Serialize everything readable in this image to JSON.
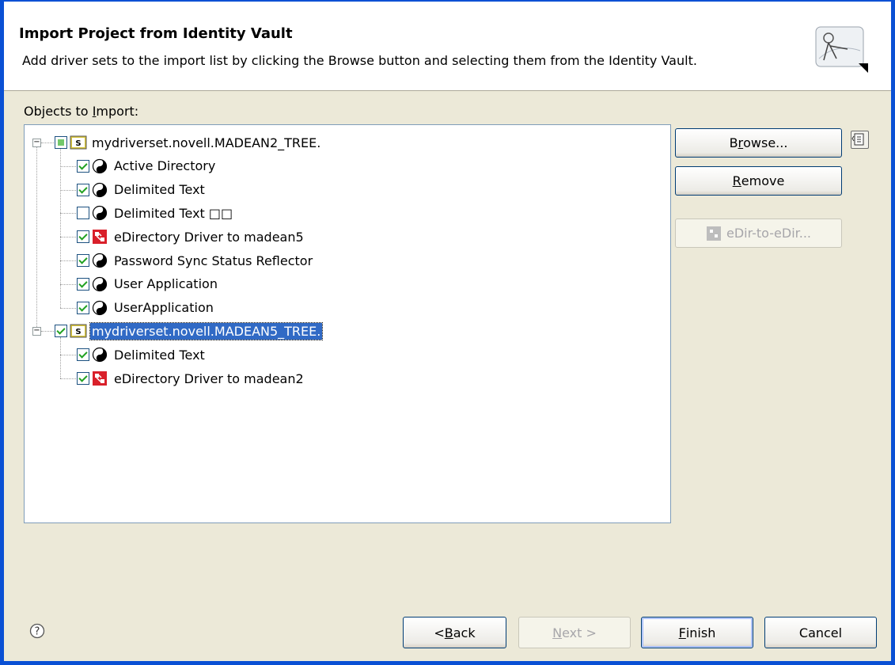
{
  "header": {
    "title": "Import Project from Identity Vault",
    "description": "Add driver sets to the import list by clicking the Browse button and selecting them from the Identity Vault.",
    "wizard_icon": "import-wizard-icon"
  },
  "objects_label_prefix": "Objects to ",
  "objects_label_mnemonic": "I",
  "objects_label_suffix": "mport:",
  "tree": {
    "nodes": [
      {
        "label": "mydriverset.novell.MADEAN2_TREE.",
        "state": "partial",
        "icon": "driverset-icon",
        "expanded": true
      },
      {
        "label": "Active Directory",
        "state": "checked",
        "icon": "driver-yinyang-icon"
      },
      {
        "label": "Delimited Text",
        "state": "checked",
        "icon": "driver-yinyang-icon"
      },
      {
        "label": "Delimited Text □□",
        "state": "unchecked",
        "icon": "driver-yinyang-icon"
      },
      {
        "label": "eDirectory Driver to madean5",
        "state": "checked",
        "icon": "edirectory-driver-icon"
      },
      {
        "label": "Password Sync Status Reflector",
        "state": "checked",
        "icon": "driver-yinyang-icon"
      },
      {
        "label": "User Application",
        "state": "checked",
        "icon": "driver-yinyang-icon"
      },
      {
        "label": "UserApplication",
        "state": "checked",
        "icon": "driver-yinyang-icon"
      },
      {
        "label": "mydriverset.novell.MADEAN5_TREE.",
        "state": "checked",
        "icon": "driverset-icon",
        "expanded": true,
        "selected": true
      },
      {
        "label": "Delimited Text",
        "state": "checked",
        "icon": "driver-yinyang-icon"
      },
      {
        "label": "eDirectory Driver to madean2",
        "state": "checked",
        "icon": "edirectory-driver-icon"
      }
    ]
  },
  "side_buttons": {
    "browse_pre": "B",
    "browse_mn": "r",
    "browse_post": "owse...",
    "remove_mn": "R",
    "remove_post": "emove",
    "edir_label": "eDir-to-eDir..."
  },
  "footer": {
    "back_pre": "< ",
    "back_mn": "B",
    "back_post": "ack",
    "next_mn": "N",
    "next_post": "ext >",
    "finish_mn": "F",
    "finish_post": "inish",
    "cancel": "Cancel"
  }
}
